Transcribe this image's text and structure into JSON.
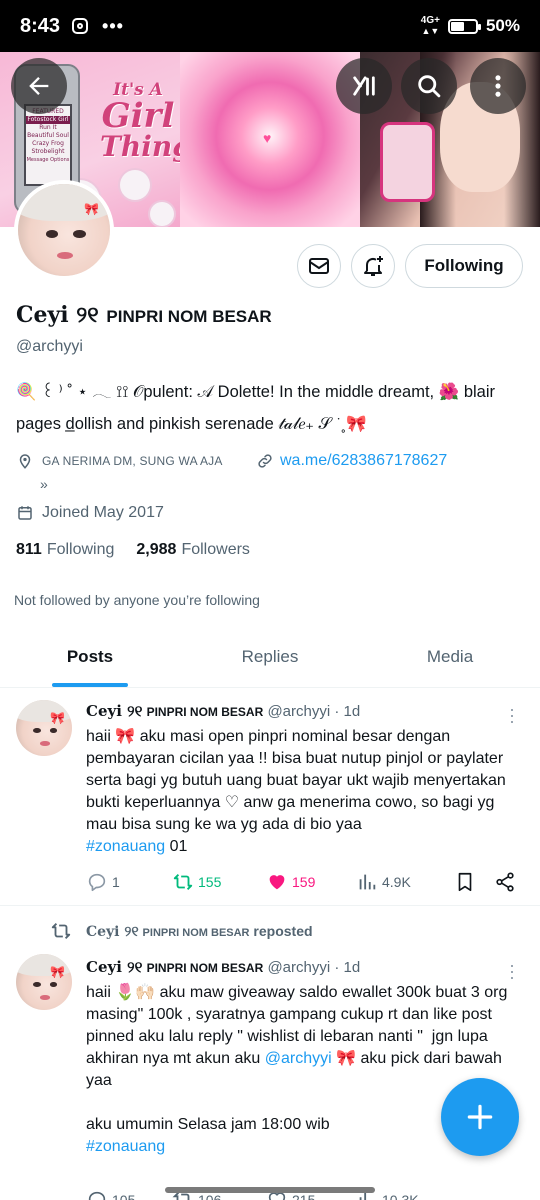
{
  "status_bar": {
    "time": "8:43",
    "network": "4G+",
    "battery": "50%",
    "battery_level": 0.5
  },
  "profile": {
    "display_name": "Ceyi ୨୧",
    "display_tag": "PINPRI NOM BESAR",
    "handle": "@archyyi",
    "bio_line1": "🍭 ꒰ ⁾ ˚ ⋆  𓂃 ⟟⟟ 𝒪pulent: 𝒜 Dolette!      In the middle dreamt, 🌺 blair",
    "bio_line2": "pages  d̲ollish and pinkish serenade 𝓉𝒶𝓁𝑒₊ 𝒮 ͘  ˳🎀",
    "location": "GA NERIMA DM, SUNG WA AJA",
    "location_more": "»",
    "website": "wa.me/6283867178627",
    "joined": "Joined May 2017",
    "following_count": "811",
    "following_label": "Following",
    "followers_count": "2,988",
    "followers_label": "Followers",
    "not_followed": "Not followed by anyone you’re following",
    "follow_button": "Following"
  },
  "banner": {
    "phone_menu": [
      "FEATURED",
      "Fotostock Girl",
      "Run It",
      "Beautiful Soul",
      "Crazy Frog",
      "Strobelight"
    ],
    "phone_footer": "Message   Options",
    "girl_text_a": "It's A",
    "girl_text_b": "Girl",
    "girl_text_c": "Thing"
  },
  "tabs": [
    {
      "label": "Posts",
      "active": true
    },
    {
      "label": "Replies",
      "active": false
    },
    {
      "label": "Media",
      "active": false
    }
  ],
  "posts": [
    {
      "name": "Ceyi ୨୧",
      "tag": "PINPRI NOM BESAR",
      "meta": "@archyyi · 1d",
      "text": "haii 🎀 aku masi open pinpri nominal besar dengan pembayaran cicilan yaa !! bisa buat nutup pinjol or paylater serta bagi yg butuh uang buat bayar ukt wajib menyertakan bukti keperluannya ♡ anw ga menerima cowo, so bagi yg mau bisa sung ke wa yg ada di bio yaa",
      "hashtag": "#zonauang",
      "hashtag_suffix": " 01",
      "replies": "1",
      "reposts": "155",
      "likes": "159",
      "views": "4.9K"
    },
    {
      "reposted_by": "Ceyi ୨୧",
      "reposted_tag": "PINPRI NOM BESAR",
      "reposted_suffix": "reposted",
      "name": "Ceyi ୨୧",
      "tag": "PINPRI NOM BESAR",
      "meta": "@archyyi · 1d",
      "text_part1": "haii 🌷🙌🏻 aku maw giveaway saldo ewallet 300k buat 3 org masing\" 100k , syaratnya gampang cukup rt dan like post pinned aku lalu reply \" wishlist di lebaran nanti \"  jgn lupa akhiran nya mt akun aku ",
      "mention": "@archyyi",
      "text_part2": " 🎀 aku pick dari bawah yaa\n\naku umumin Selasa jam 18:00 wib",
      "hashtag": "#zonauang",
      "replies": "105",
      "reposts": "106",
      "likes": "215",
      "views": "10.3K"
    }
  ],
  "colors": {
    "accent": "#1d9bf0",
    "like": "#f91880",
    "repost": "#00ba7c",
    "muted": "#536471"
  },
  "icons": [
    "back-arrow-icon",
    "grok-icon",
    "search-icon",
    "more-vertical-icon",
    "mail-icon",
    "bell-plus-icon",
    "location-icon",
    "link-icon",
    "calendar-icon",
    "reply-icon",
    "repost-icon",
    "heart-icon",
    "views-icon",
    "bookmark-icon",
    "share-icon",
    "plus-icon"
  ]
}
